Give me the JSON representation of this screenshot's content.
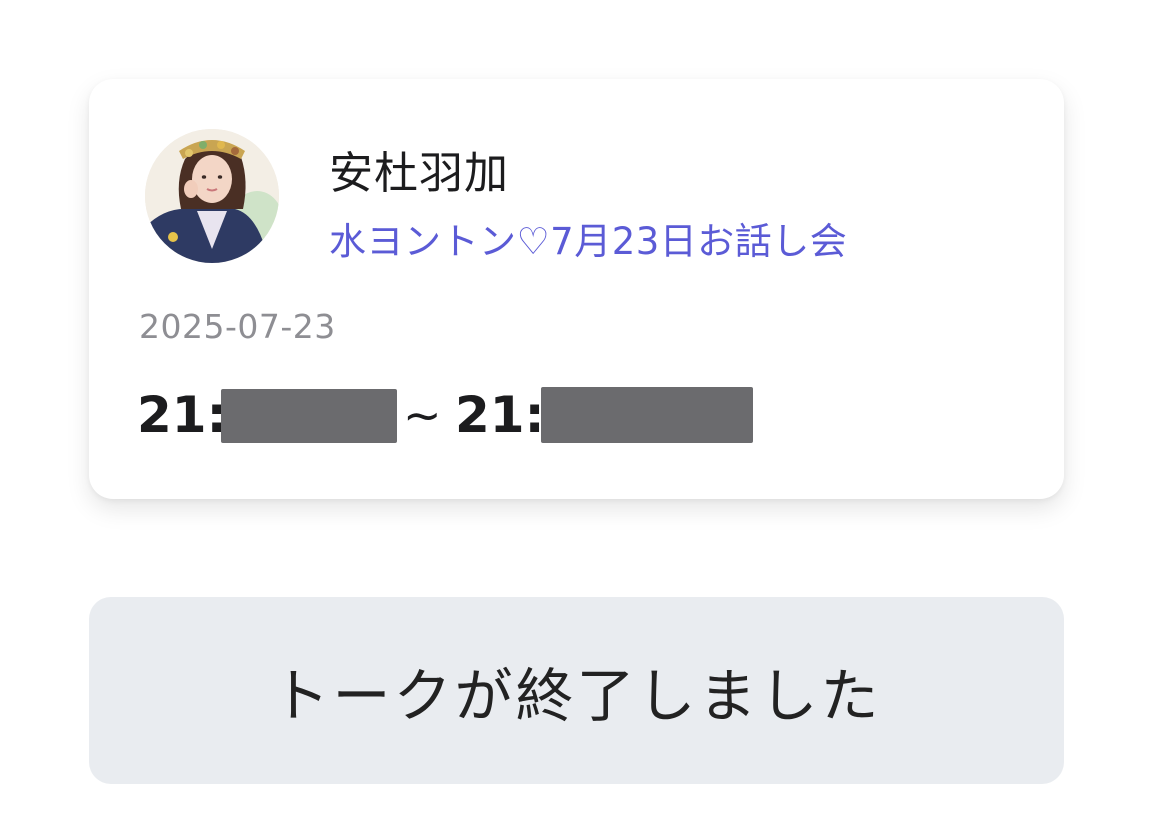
{
  "card": {
    "name": "安杜羽加",
    "event": "水ヨントン♡7月23日お話し会",
    "date": "2025-07-23",
    "start_time": "21:",
    "separator": "~",
    "end_time": "21:"
  },
  "status": {
    "label": "トークが終了しました"
  },
  "colors": {
    "accent": "#5b5bd6",
    "status_bg": "#e9ecf0",
    "redaction": "#6b6b6e"
  }
}
